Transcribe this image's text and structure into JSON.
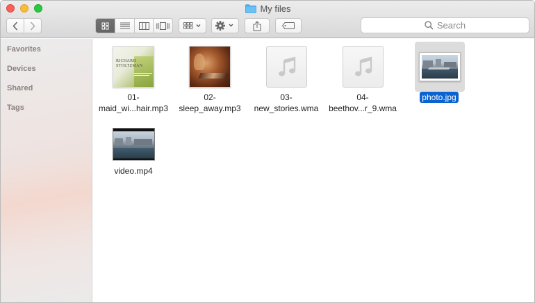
{
  "window": {
    "title": "My files"
  },
  "toolbar": {
    "back": "chevron-left-icon",
    "forward": "chevron-right-icon",
    "views": [
      "icon-view",
      "list-view",
      "column-view",
      "cover-flow-view"
    ],
    "arrange": "arrange-icon",
    "action": "gear-icon",
    "share": "share-icon",
    "tags": "tag-icon"
  },
  "search": {
    "placeholder": "Search"
  },
  "sidebar": {
    "items": [
      {
        "label": "Favorites"
      },
      {
        "label": "Devices"
      },
      {
        "label": "Shared"
      },
      {
        "label": "Tags"
      }
    ]
  },
  "files": [
    {
      "line1": "01-",
      "line2": "maid_wi...hair.mp3",
      "cover_title": "RICHARD STOLTZMAN"
    },
    {
      "line1": "02-",
      "line2": "sleep_away.mp3"
    },
    {
      "line1": "03-",
      "line2": "new_stories.wma"
    },
    {
      "line1": "04-",
      "line2": "beethov...r_9.wma"
    },
    {
      "line1": "photo.jpg",
      "line2": "",
      "selected": true
    },
    {
      "line1": "video.mp4",
      "line2": ""
    }
  ],
  "colors": {
    "selection": "#0b63d1",
    "close": "#fc5f57",
    "minimize": "#fdbc2e",
    "maximize": "#28c840"
  }
}
